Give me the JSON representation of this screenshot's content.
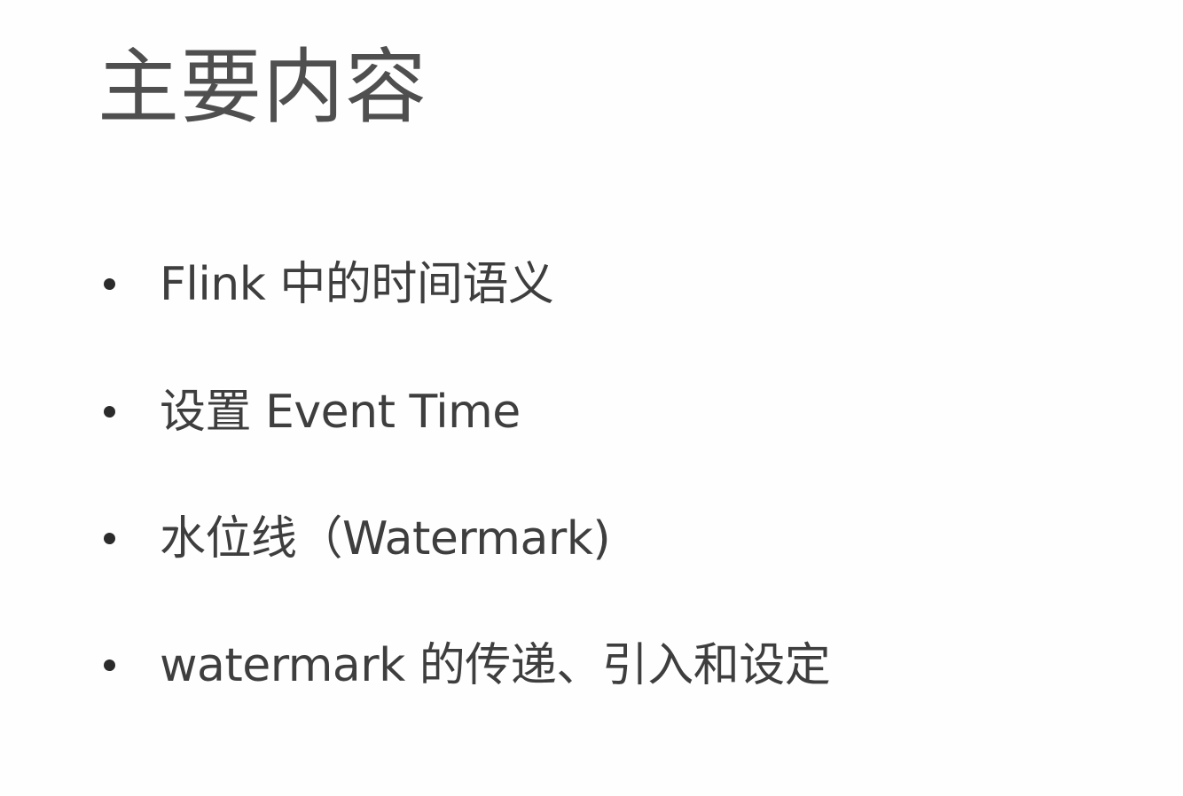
{
  "slide": {
    "title": "主要内容",
    "bullets": [
      "Flink 中的时间语义",
      "设置 Event Time",
      "水位线（Watermark)",
      "watermark 的传递、引入和设定"
    ]
  },
  "colors": {
    "background": "#fefefe",
    "title": "#4f4f4f",
    "text": "#3e3e3e",
    "bullet": "#2b2b2b"
  }
}
